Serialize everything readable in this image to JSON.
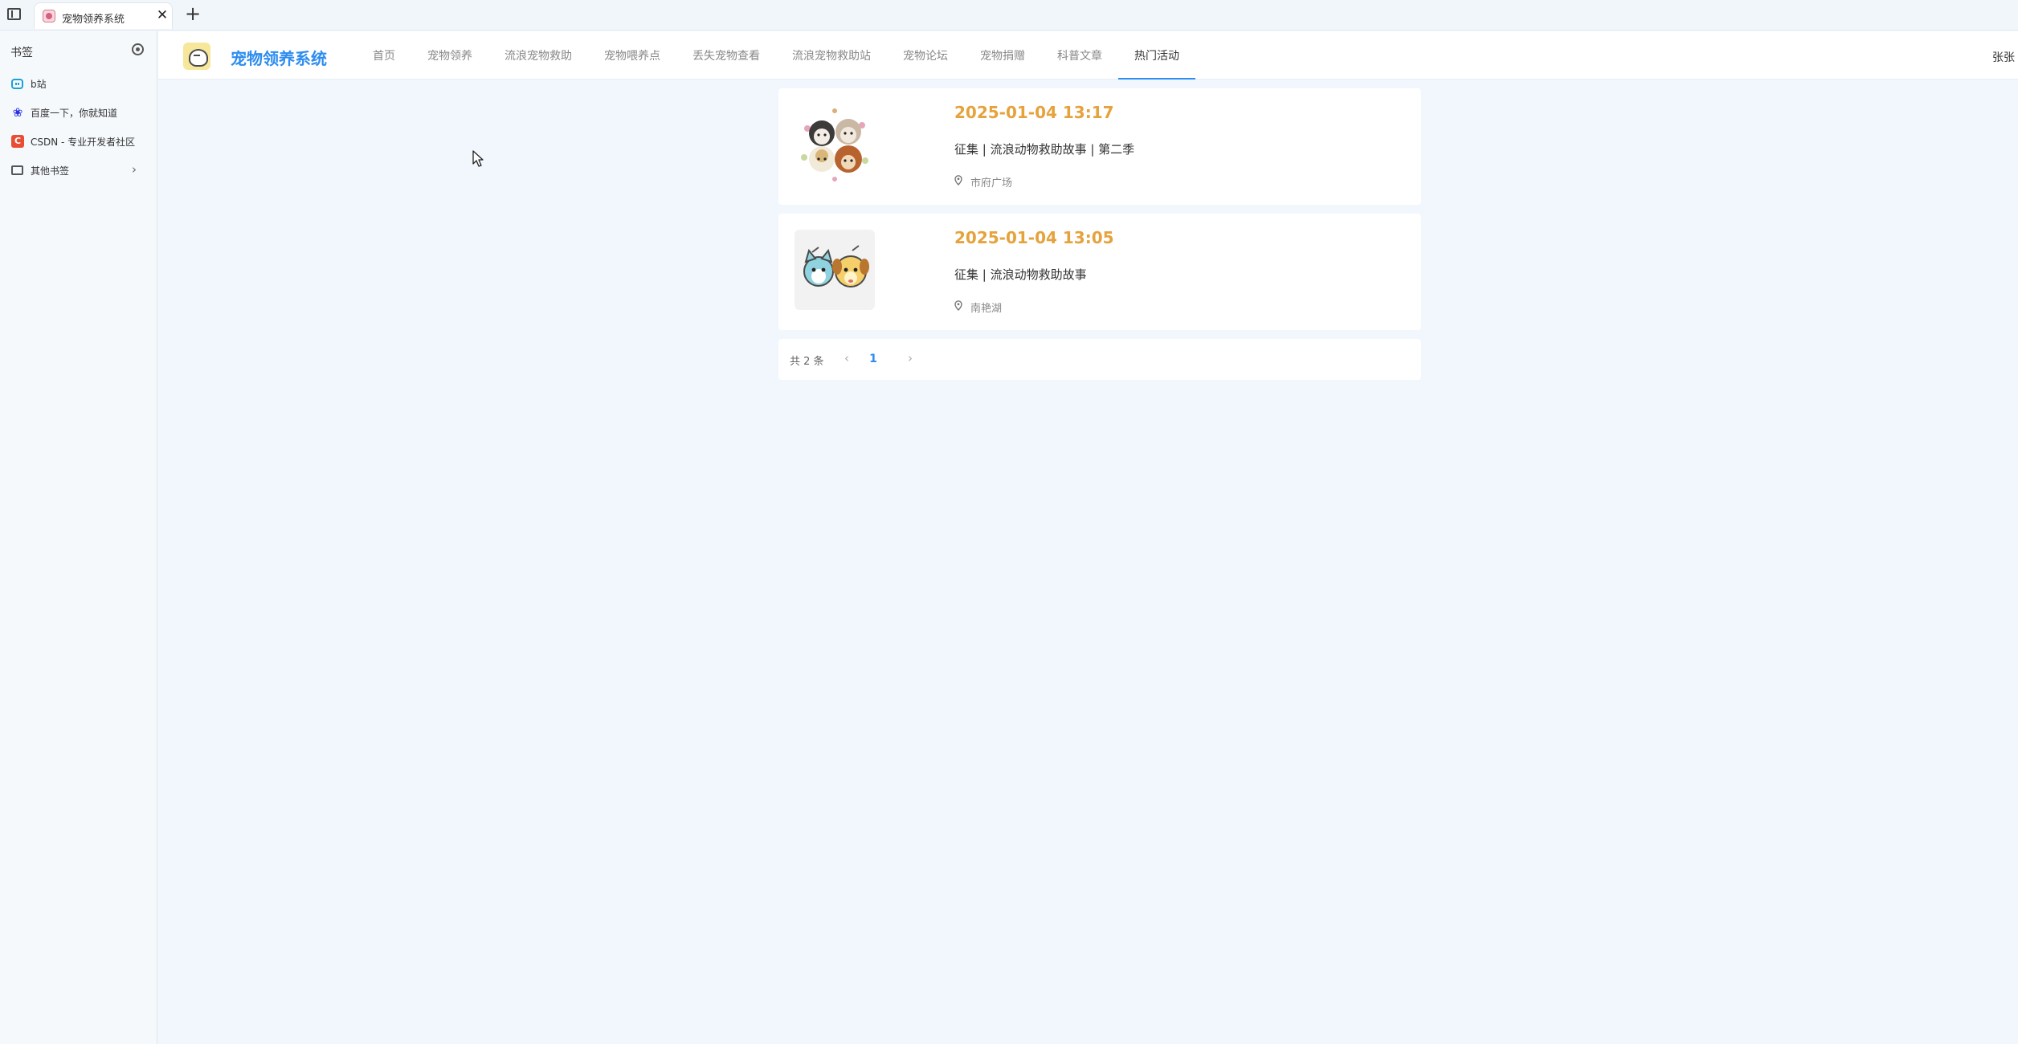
{
  "browser": {
    "tab_title": "宠物领养系统",
    "tab_close": "✕",
    "new_tab": "+"
  },
  "bookmarks": {
    "header": "书签",
    "items": [
      {
        "label": "b站",
        "icon": "bilibili-icon"
      },
      {
        "label": "百度一下，你就知道",
        "icon": "baidu-icon"
      },
      {
        "label": "CSDN - 专业开发者社区",
        "icon": "csdn-icon",
        "icon_text": "C"
      },
      {
        "label": "其他书签",
        "icon": "folder-icon"
      }
    ]
  },
  "header": {
    "app_title": "宠物领养系统",
    "nav": [
      "首页",
      "宠物领养",
      "流浪宠物救助",
      "宠物喂养点",
      "丢失宠物查看",
      "流浪宠物救助站",
      "宠物论坛",
      "宠物捐赠",
      "科普文章",
      "热门活动"
    ],
    "active_nav": "热门活动",
    "user": "张张"
  },
  "activities": [
    {
      "date": "2025-01-04 13:17",
      "title": "征集 | 流浪动物救助故事 | 第二季",
      "location": "市府广场"
    },
    {
      "date": "2025-01-04 13:05",
      "title": "征集 | 流浪动物救助故事",
      "location": "南艳湖"
    }
  ],
  "pagination": {
    "total_text": "共 2 条",
    "prev": "‹",
    "current_page": "1",
    "next": "›"
  },
  "colors": {
    "brand": "#2d8cf0",
    "date_accent": "#e6a23c",
    "page_bg": "#f1f7fd"
  }
}
